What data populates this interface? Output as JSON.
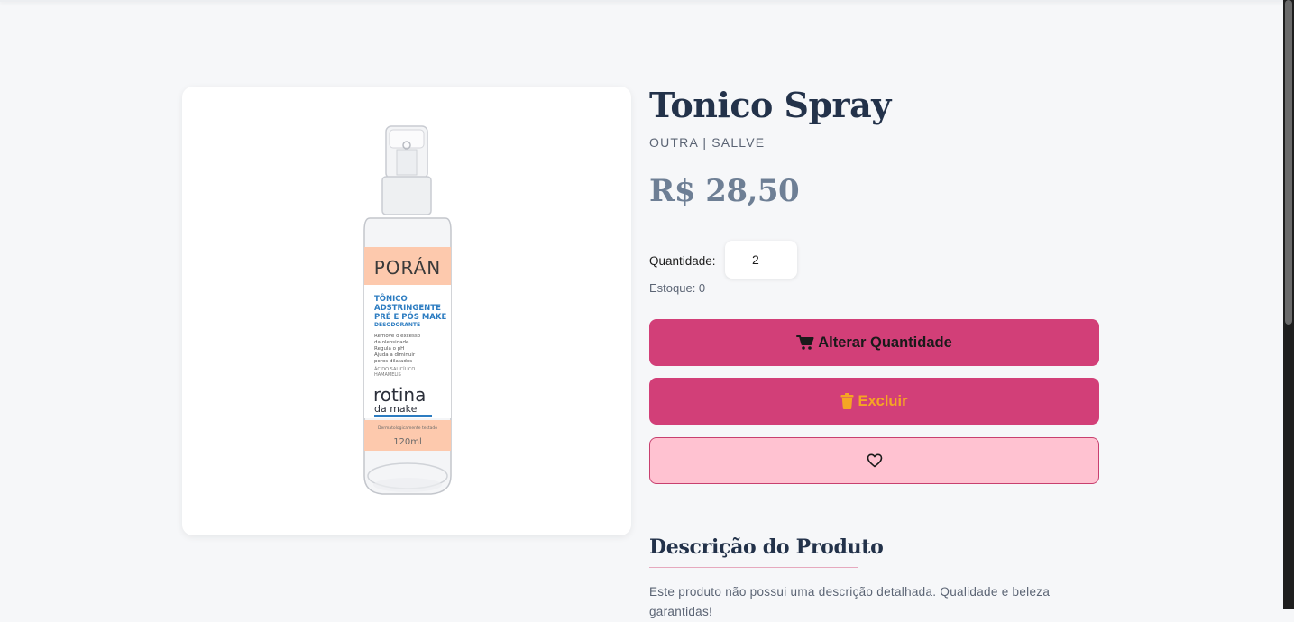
{
  "product": {
    "title": "Tonico Spray",
    "brand": "OUTRA | SALLVE",
    "price": "R$ 28,50",
    "image": {
      "label_brand": "PORÁN",
      "label_line1": "TÔNICO",
      "label_line2": "ADSTRINGENTE",
      "label_line3": "PRÉ E PÓS MAKE",
      "label_line4": "DESODORANTE",
      "label_benefit1": "Remove o excesso",
      "label_benefit2": "da oleosidade",
      "label_benefit3": "Regula o pH",
      "label_benefit4": "Ajuda a diminuir",
      "label_benefit5": "poros dilatados",
      "label_ingredient1": "ÁCIDO SALICÍLICO",
      "label_ingredient2": "HAMAMELIS",
      "label_line_big": "rotina",
      "label_line_sub": "da make",
      "label_tested": "Dermatologicamente testado",
      "label_volume": "120ml"
    }
  },
  "quantity": {
    "label": "Quantidade:",
    "value": "2"
  },
  "stock": {
    "text": "Estoque: 0"
  },
  "buttons": {
    "alter_label": "Alterar Quantidade",
    "delete_label": "Excluir",
    "favorite_icon": "heart-icon"
  },
  "description": {
    "title": "Descrição do Produto",
    "text": "Este produto não possui uma descrição detalhada. Qualidade e beleza garantidas!"
  },
  "colors": {
    "accent": "#d23f78",
    "favorite_bg": "#ffc2d1",
    "delete_text": "#f5a524",
    "heading": "#23324a",
    "price": "#6e7f95"
  },
  "icons": {
    "alter": "cart-icon",
    "delete": "trash-icon",
    "favorite": "heart-icon"
  }
}
